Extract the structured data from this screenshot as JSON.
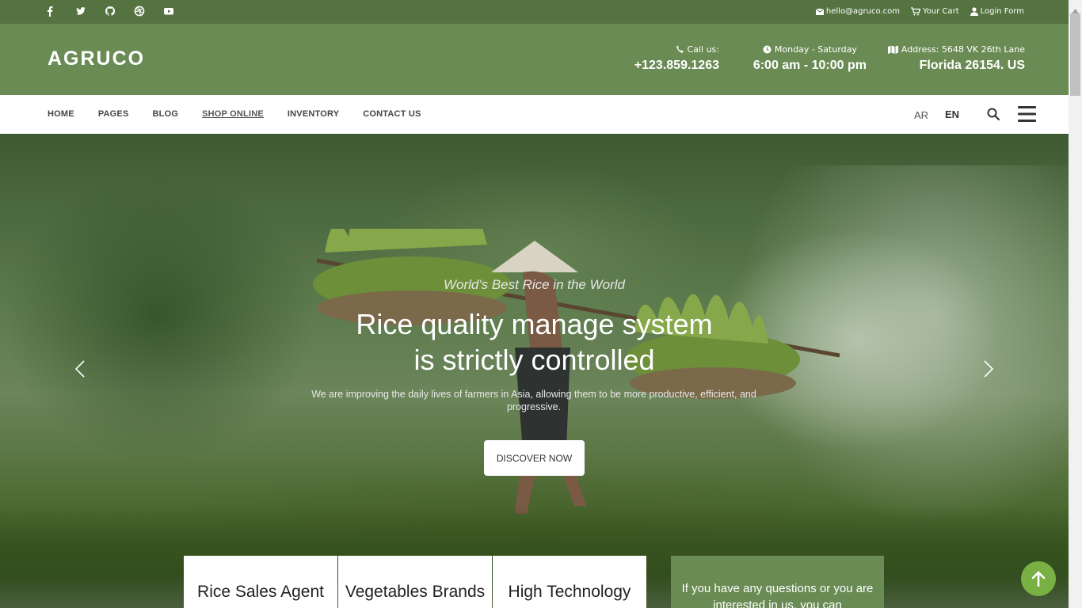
{
  "topbar": {
    "social_icons": [
      "facebook-icon",
      "twitter-icon",
      "github-icon",
      "dribbble-icon",
      "youtube-icon"
    ],
    "email": "hello@agruco.com",
    "cart": "Your Cart",
    "login": "Login Form"
  },
  "header": {
    "logo": "AGRUCO",
    "call_label": "Call us:",
    "call_value": "+123.859.1263",
    "hours_label": "Monday - Saturday",
    "hours_value": "6:00 am - 10:00 pm",
    "address_label": "Address: 5648 VK 26th Lane",
    "address_value": "Florida 26154. US"
  },
  "nav": {
    "items": [
      {
        "label": "HOME"
      },
      {
        "label": "PAGES"
      },
      {
        "label": "BLOG"
      },
      {
        "label": "SHOP ONLINE"
      },
      {
        "label": "INVENTORY"
      },
      {
        "label": "CONTACT US"
      }
    ],
    "active_index": 3,
    "lang_ar": "AR",
    "lang_en": "EN"
  },
  "hero": {
    "subtitle": "World's Best Rice in the World",
    "title_line1": "Rice quality manage system",
    "title_line2": "is strictly controlled",
    "description": "We are improving the daily lives of farmers in Asia, allowing them to be more productive, efficient, and progressive.",
    "button": "DISCOVER NOW"
  },
  "cards": [
    {
      "title": "Rice Sales Agent"
    },
    {
      "title": "Vegetables Brands"
    },
    {
      "title": "High Technology"
    }
  ],
  "contact_box": {
    "text": "If you have any questions or you are interested in us, you can"
  },
  "colors": {
    "topbar": "#547340",
    "header": "#6a8b54",
    "to_top": "#78b043"
  }
}
